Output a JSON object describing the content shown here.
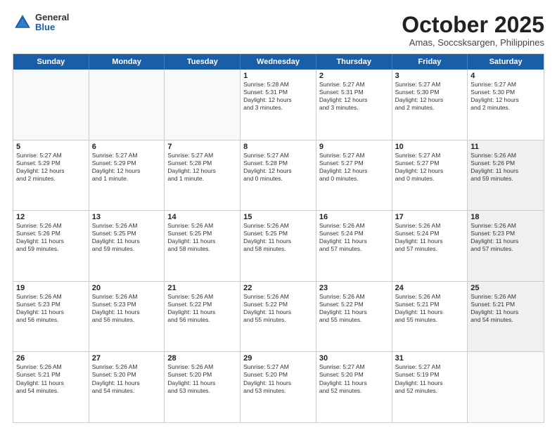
{
  "logo": {
    "general": "General",
    "blue": "Blue"
  },
  "header": {
    "month": "October 2025",
    "location": "Amas, Soccsksargen, Philippines"
  },
  "weekdays": [
    "Sunday",
    "Monday",
    "Tuesday",
    "Wednesday",
    "Thursday",
    "Friday",
    "Saturday"
  ],
  "rows": [
    [
      {
        "day": "",
        "text": "",
        "empty": true
      },
      {
        "day": "",
        "text": "",
        "empty": true
      },
      {
        "day": "",
        "text": "",
        "empty": true
      },
      {
        "day": "1",
        "text": "Sunrise: 5:28 AM\nSunset: 5:31 PM\nDaylight: 12 hours\nand 3 minutes."
      },
      {
        "day": "2",
        "text": "Sunrise: 5:27 AM\nSunset: 5:31 PM\nDaylight: 12 hours\nand 3 minutes."
      },
      {
        "day": "3",
        "text": "Sunrise: 5:27 AM\nSunset: 5:30 PM\nDaylight: 12 hours\nand 2 minutes."
      },
      {
        "day": "4",
        "text": "Sunrise: 5:27 AM\nSunset: 5:30 PM\nDaylight: 12 hours\nand 2 minutes."
      }
    ],
    [
      {
        "day": "5",
        "text": "Sunrise: 5:27 AM\nSunset: 5:29 PM\nDaylight: 12 hours\nand 2 minutes."
      },
      {
        "day": "6",
        "text": "Sunrise: 5:27 AM\nSunset: 5:29 PM\nDaylight: 12 hours\nand 1 minute."
      },
      {
        "day": "7",
        "text": "Sunrise: 5:27 AM\nSunset: 5:28 PM\nDaylight: 12 hours\nand 1 minute."
      },
      {
        "day": "8",
        "text": "Sunrise: 5:27 AM\nSunset: 5:28 PM\nDaylight: 12 hours\nand 0 minutes."
      },
      {
        "day": "9",
        "text": "Sunrise: 5:27 AM\nSunset: 5:27 PM\nDaylight: 12 hours\nand 0 minutes."
      },
      {
        "day": "10",
        "text": "Sunrise: 5:27 AM\nSunset: 5:27 PM\nDaylight: 12 hours\nand 0 minutes."
      },
      {
        "day": "11",
        "text": "Sunrise: 5:26 AM\nSunset: 5:26 PM\nDaylight: 11 hours\nand 59 minutes.",
        "shaded": true
      }
    ],
    [
      {
        "day": "12",
        "text": "Sunrise: 5:26 AM\nSunset: 5:26 PM\nDaylight: 11 hours\nand 59 minutes."
      },
      {
        "day": "13",
        "text": "Sunrise: 5:26 AM\nSunset: 5:25 PM\nDaylight: 11 hours\nand 59 minutes."
      },
      {
        "day": "14",
        "text": "Sunrise: 5:26 AM\nSunset: 5:25 PM\nDaylight: 11 hours\nand 58 minutes."
      },
      {
        "day": "15",
        "text": "Sunrise: 5:26 AM\nSunset: 5:25 PM\nDaylight: 11 hours\nand 58 minutes."
      },
      {
        "day": "16",
        "text": "Sunrise: 5:26 AM\nSunset: 5:24 PM\nDaylight: 11 hours\nand 57 minutes."
      },
      {
        "day": "17",
        "text": "Sunrise: 5:26 AM\nSunset: 5:24 PM\nDaylight: 11 hours\nand 57 minutes."
      },
      {
        "day": "18",
        "text": "Sunrise: 5:26 AM\nSunset: 5:23 PM\nDaylight: 11 hours\nand 57 minutes.",
        "shaded": true
      }
    ],
    [
      {
        "day": "19",
        "text": "Sunrise: 5:26 AM\nSunset: 5:23 PM\nDaylight: 11 hours\nand 56 minutes."
      },
      {
        "day": "20",
        "text": "Sunrise: 5:26 AM\nSunset: 5:23 PM\nDaylight: 11 hours\nand 56 minutes."
      },
      {
        "day": "21",
        "text": "Sunrise: 5:26 AM\nSunset: 5:22 PM\nDaylight: 11 hours\nand 56 minutes."
      },
      {
        "day": "22",
        "text": "Sunrise: 5:26 AM\nSunset: 5:22 PM\nDaylight: 11 hours\nand 55 minutes."
      },
      {
        "day": "23",
        "text": "Sunrise: 5:26 AM\nSunset: 5:22 PM\nDaylight: 11 hours\nand 55 minutes."
      },
      {
        "day": "24",
        "text": "Sunrise: 5:26 AM\nSunset: 5:21 PM\nDaylight: 11 hours\nand 55 minutes."
      },
      {
        "day": "25",
        "text": "Sunrise: 5:26 AM\nSunset: 5:21 PM\nDaylight: 11 hours\nand 54 minutes.",
        "shaded": true
      }
    ],
    [
      {
        "day": "26",
        "text": "Sunrise: 5:26 AM\nSunset: 5:21 PM\nDaylight: 11 hours\nand 54 minutes."
      },
      {
        "day": "27",
        "text": "Sunrise: 5:26 AM\nSunset: 5:20 PM\nDaylight: 11 hours\nand 54 minutes."
      },
      {
        "day": "28",
        "text": "Sunrise: 5:26 AM\nSunset: 5:20 PM\nDaylight: 11 hours\nand 53 minutes."
      },
      {
        "day": "29",
        "text": "Sunrise: 5:27 AM\nSunset: 5:20 PM\nDaylight: 11 hours\nand 53 minutes."
      },
      {
        "day": "30",
        "text": "Sunrise: 5:27 AM\nSunset: 5:20 PM\nDaylight: 11 hours\nand 52 minutes."
      },
      {
        "day": "31",
        "text": "Sunrise: 5:27 AM\nSunset: 5:19 PM\nDaylight: 11 hours\nand 52 minutes."
      },
      {
        "day": "",
        "text": "",
        "empty": true
      }
    ]
  ]
}
